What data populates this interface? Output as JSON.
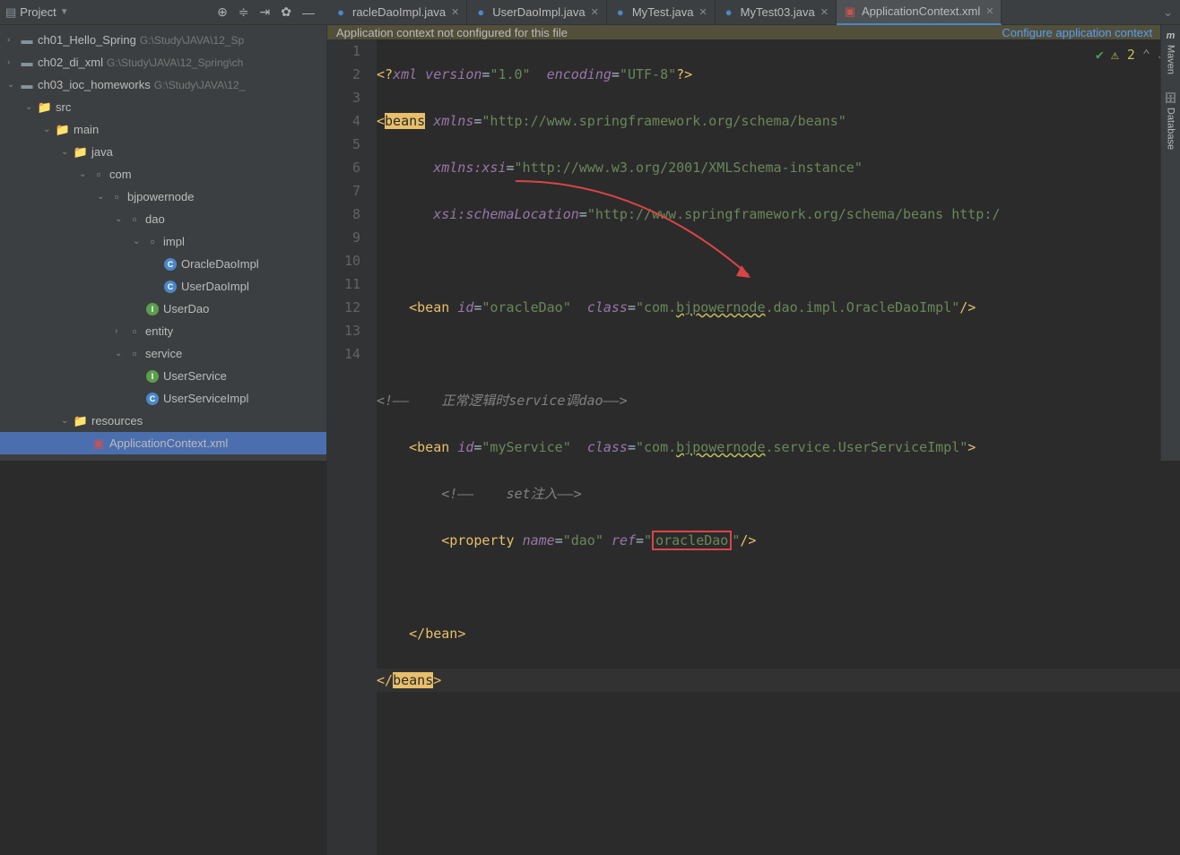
{
  "toolbar": {
    "project_label": "Project"
  },
  "tabs": [
    {
      "label": "racleDaoImpl.java",
      "icon": "java",
      "active": false
    },
    {
      "label": "UserDaoImpl.java",
      "icon": "java",
      "active": false
    },
    {
      "label": "MyTest.java",
      "icon": "java",
      "active": false
    },
    {
      "label": "MyTest03.java",
      "icon": "java",
      "active": false
    },
    {
      "label": "ApplicationContext.xml",
      "icon": "xml",
      "active": true
    }
  ],
  "banner": {
    "message": "Application context not configured for this file",
    "link": "Configure application context"
  },
  "tree": [
    {
      "indent": 8,
      "chevron": "›",
      "icon": "module",
      "label": "ch01_Hello_Spring",
      "path": "G:\\Study\\JAVA\\12_Sp"
    },
    {
      "indent": 8,
      "chevron": "›",
      "icon": "module",
      "label": "ch02_di_xml",
      "path": "G:\\Study\\JAVA\\12_Spring\\ch"
    },
    {
      "indent": 8,
      "chevron": "⌄",
      "icon": "module",
      "label": "ch03_ioc_homeworks",
      "path": "G:\\Study\\JAVA\\12_"
    },
    {
      "indent": 28,
      "chevron": "⌄",
      "icon": "folder",
      "label": "src",
      "path": ""
    },
    {
      "indent": 48,
      "chevron": "⌄",
      "icon": "folder",
      "label": "main",
      "path": ""
    },
    {
      "indent": 68,
      "chevron": "⌄",
      "icon": "folder-src",
      "label": "java",
      "path": ""
    },
    {
      "indent": 88,
      "chevron": "⌄",
      "icon": "package",
      "label": "com",
      "path": ""
    },
    {
      "indent": 108,
      "chevron": "⌄",
      "icon": "package",
      "label": "bjpowernode",
      "path": ""
    },
    {
      "indent": 128,
      "chevron": "⌄",
      "icon": "package",
      "label": "dao",
      "path": ""
    },
    {
      "indent": 148,
      "chevron": "⌄",
      "icon": "package",
      "label": "impl",
      "path": ""
    },
    {
      "indent": 168,
      "chevron": "",
      "icon": "class",
      "label": "OracleDaoImpl",
      "path": ""
    },
    {
      "indent": 168,
      "chevron": "",
      "icon": "class",
      "label": "UserDaoImpl",
      "path": ""
    },
    {
      "indent": 148,
      "chevron": "",
      "icon": "interface",
      "label": "UserDao",
      "path": ""
    },
    {
      "indent": 128,
      "chevron": "›",
      "icon": "package",
      "label": "entity",
      "path": ""
    },
    {
      "indent": 128,
      "chevron": "⌄",
      "icon": "package",
      "label": "service",
      "path": ""
    },
    {
      "indent": 148,
      "chevron": "",
      "icon": "interface",
      "label": "UserService",
      "path": ""
    },
    {
      "indent": 148,
      "chevron": "",
      "icon": "class",
      "label": "UserServiceImpl",
      "path": ""
    },
    {
      "indent": 68,
      "chevron": "⌄",
      "icon": "folder-res",
      "label": "resources",
      "path": ""
    },
    {
      "indent": 88,
      "chevron": "",
      "icon": "xml",
      "label": "ApplicationContext.xml",
      "path": "",
      "selected": true
    }
  ],
  "status": {
    "warn_count": "2"
  },
  "gutter_lines": [
    "1",
    "2",
    "3",
    "4",
    "5",
    "6",
    "7",
    "8",
    "9",
    "10",
    "11",
    "12",
    "13",
    "14"
  ],
  "code": {
    "l1_a": "<?",
    "l1_b": "xml version",
    "l1_c": "=",
    "l1_d": "\"1.0\"",
    "l1_e": "encoding",
    "l1_f": "=",
    "l1_g": "\"UTF-8\"",
    "l1_h": "?>",
    "l2_a": "<",
    "l2_b": "beans",
    "l2_c": "xmlns",
    "l2_d": "=",
    "l2_e": "\"http://www.springframework.org/schema/beans\"",
    "l3_a": "xmlns:xsi",
    "l3_b": "=",
    "l3_c": "\"http://www.w3.org/2001/XMLSchema-instance\"",
    "l4_a": "xsi:schemaLocation",
    "l4_b": "=",
    "l4_c": "\"http://www.springframework.org/schema/beans http:/",
    "l6_a": "<",
    "l6_b": "bean",
    "l6_c": "id",
    "l6_d": "=",
    "l6_e": "\"oracleDao\"",
    "l6_f": "class",
    "l6_g": "=",
    "l6_h": "\"com.",
    "l6_i": "bjpowernode",
    "l6_j": ".dao.impl.OracleDaoImpl\"",
    "l6_k": "/>",
    "l8_a": "<!——    正常逻辑时service调dao——>",
    "l9_a": "<",
    "l9_b": "bean",
    "l9_c": "id",
    "l9_d": "=",
    "l9_e": "\"myService\"",
    "l9_f": "class",
    "l9_g": "=",
    "l9_h": "\"com.",
    "l9_i": "bjpowernode",
    "l9_j": ".service.UserServiceImpl\"",
    "l9_k": ">",
    "l10_a": "<!——    set注入——>",
    "l11_a": "<",
    "l11_b": "property",
    "l11_c": "name",
    "l11_d": "=",
    "l11_e": "\"dao\"",
    "l11_f": "ref",
    "l11_g": "=",
    "l11_h": "\"",
    "l11_i": "oracleDao",
    "l11_j": "\"",
    "l11_k": "/>",
    "l13_a": "</",
    "l13_b": "bean",
    "l13_c": ">",
    "l14_a": "</",
    "l14_b": "beans",
    "l14_c": ">"
  },
  "right_sidebar": {
    "maven": "Maven",
    "database": "Database"
  }
}
